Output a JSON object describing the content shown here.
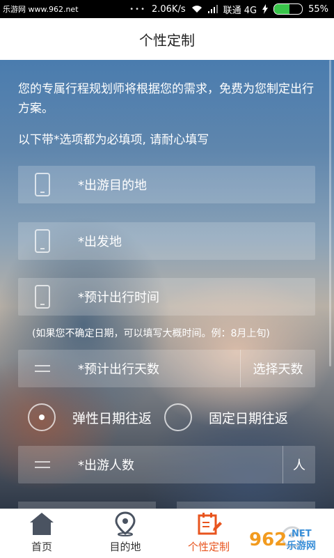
{
  "status_bar": {
    "watermark": "乐游网 www.962.net",
    "net_speed": "2.06K/s",
    "carrier": "联通 4G",
    "battery_percent": "55%",
    "battery_level": 0.55,
    "icons": [
      "wifi-icon",
      "signal-icon",
      "charging-icon",
      "battery-icon"
    ]
  },
  "header": {
    "title": "个性定制"
  },
  "intro": {
    "description": "您的专属行程规划师将根据您的需求，免费为您制定出行方案。",
    "required_notice": "以下带*选项都为必填项, 请耐心填写"
  },
  "form": {
    "destination": "*出游目的地",
    "departure": "*出发地",
    "travel_time": "*预计出行时间",
    "date_hint": "(如果您不确定日期，可以填写大概时间。例：8月上旬)",
    "days_label": "*预计出行天数",
    "days_button": "选择天数",
    "trip_options": [
      "弹性日期往返",
      "固定日期往返"
    ],
    "selected_option": "弹性日期往返",
    "people_label": "*出游人数",
    "people_unit": "人"
  },
  "bottom_nav": {
    "items": [
      {
        "label": "首页",
        "icon": "home-icon"
      },
      {
        "label": "目的地",
        "icon": "location-pin-icon"
      },
      {
        "label": "个性定制",
        "icon": "edit-calendar-icon"
      },
      {
        "label": "",
        "icon": "profile-icon"
      }
    ],
    "active_index": 2,
    "active_color": "#e8541e"
  },
  "watermark_logo": "962 乐游网 .NET"
}
